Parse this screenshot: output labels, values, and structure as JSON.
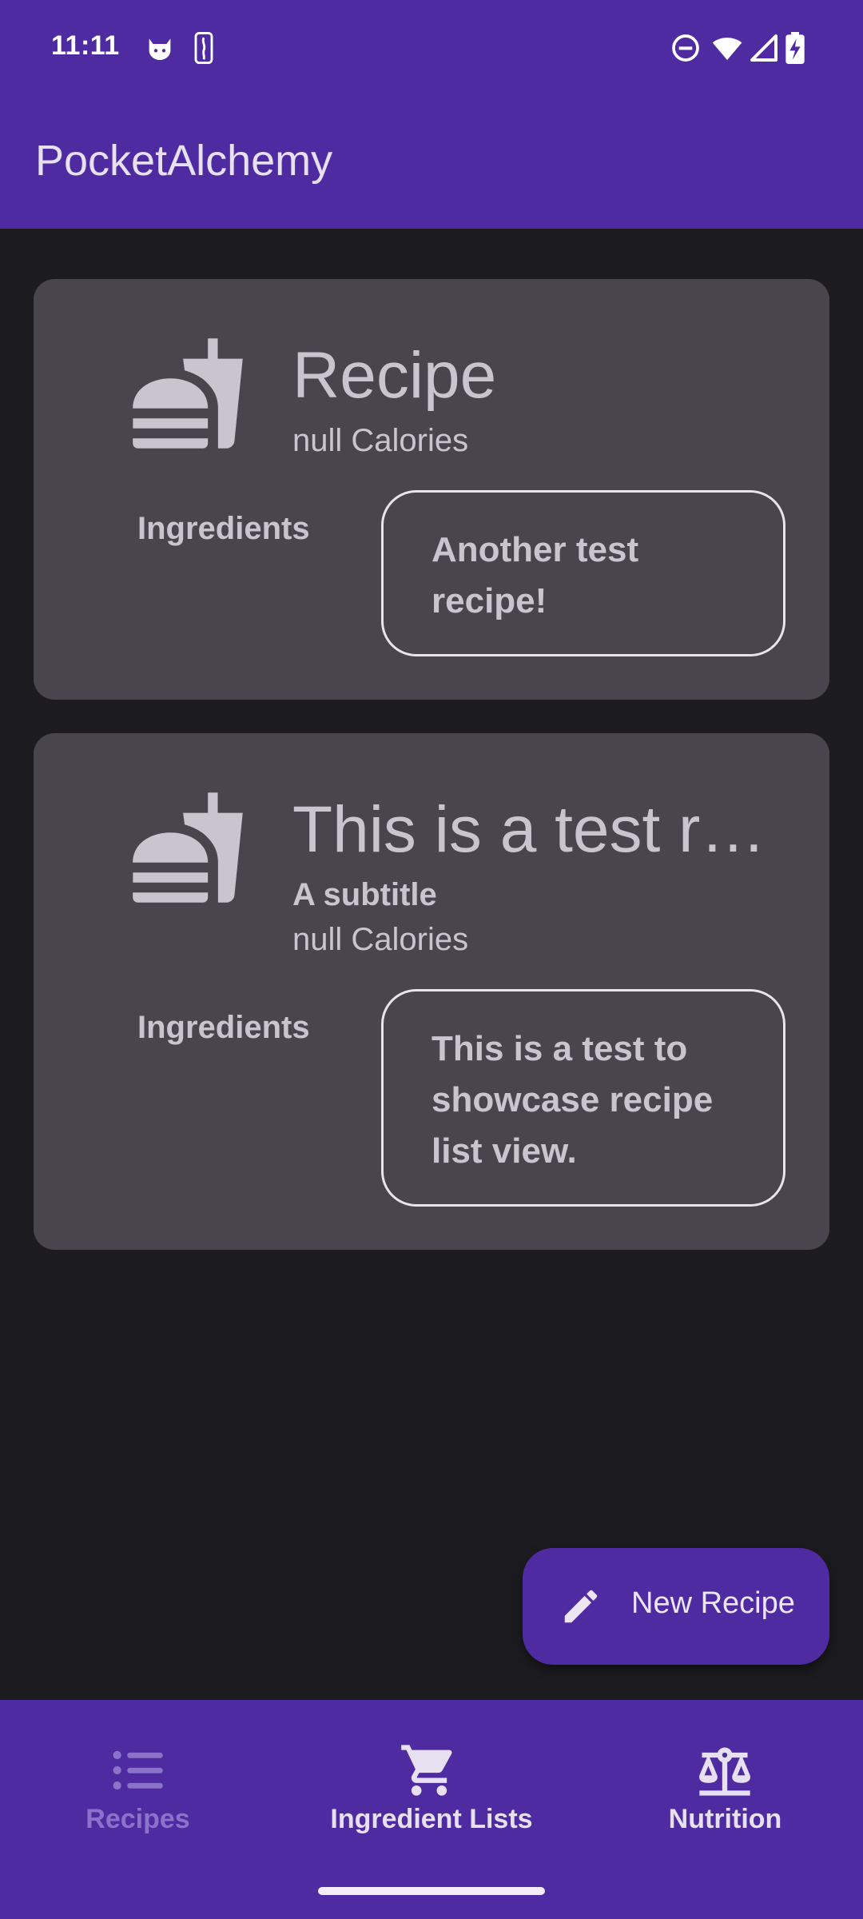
{
  "status_bar": {
    "time": "11:11",
    "left_icons": [
      "cat-face-icon",
      "nba-logo-icon"
    ],
    "right_icons": [
      "do-not-disturb-icon",
      "wifi-icon",
      "cellular-signal-icon",
      "battery-charging-icon"
    ]
  },
  "app_bar": {
    "title": "PocketAlchemy"
  },
  "recipes": [
    {
      "title": "Recipe",
      "subtitle": "",
      "calories": "null Calories",
      "ingredients_label": "Ingredients",
      "description": "Another test\nrecipe!",
      "icon": "fastfood-icon"
    },
    {
      "title": "This is a test r…",
      "subtitle": "A subtitle",
      "calories": "null Calories",
      "ingredients_label": "Ingredients",
      "description": "This is a test to\nshowcase recipe\nlist view.",
      "icon": "fastfood-icon"
    }
  ],
  "fab": {
    "label": "New Recipe",
    "icon": "pencil-icon"
  },
  "bottom_nav": {
    "items": [
      {
        "label": "Recipes",
        "icon": "list-icon",
        "selected": false
      },
      {
        "label": "Ingredient Lists",
        "icon": "shopping-cart-icon",
        "selected": true
      },
      {
        "label": "Nutrition",
        "icon": "scale-balance-icon",
        "selected": true
      }
    ]
  },
  "colors": {
    "primary": "#4f2ba1",
    "background": "#1c1b1f",
    "card": "#49454f",
    "card_text": "#cac4d0",
    "nav_active": "#e6e0f0",
    "nav_inactive": "#8a73c9"
  }
}
